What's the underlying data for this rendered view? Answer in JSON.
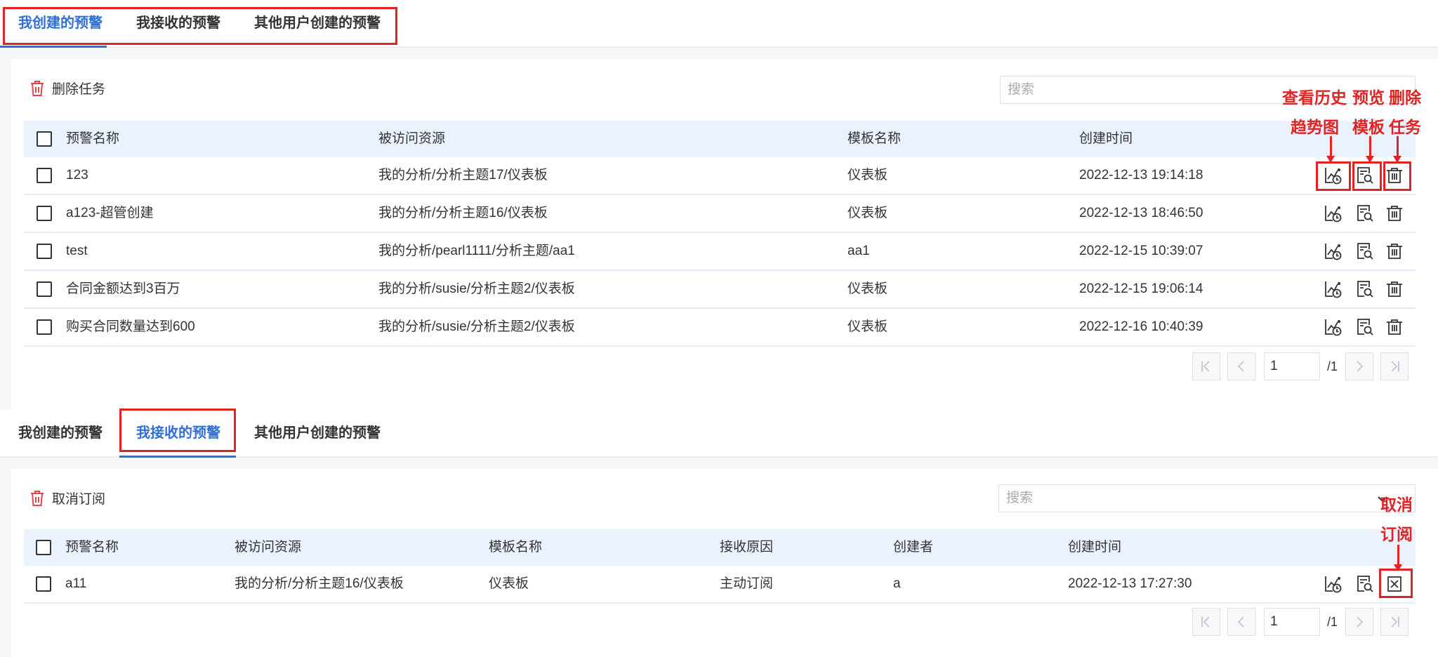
{
  "section1": {
    "tabs": [
      "我创建的预警",
      "我接收的预警",
      "其他用户创建的预警"
    ],
    "active_tab": 0,
    "toolbar": {
      "delete_label": "删除任务"
    },
    "search": {
      "placeholder": "搜索"
    },
    "columns": [
      "预警名称",
      "被访问资源",
      "模板名称",
      "创建时间"
    ],
    "rows": [
      {
        "name": "123",
        "resource": "我的分析/分析主题17/仪表板",
        "template": "仪表板",
        "created": "2022-12-13 19:14:18"
      },
      {
        "name": "a123-超管创建",
        "resource": "我的分析/分析主题16/仪表板",
        "template": "仪表板",
        "created": "2022-12-13 18:46:50"
      },
      {
        "name": "test",
        "resource": "我的分析/pearl1111/分析主题/aa1",
        "template": "aa1",
        "created": "2022-12-15 10:39:07"
      },
      {
        "name": "合同金额达到3百万",
        "resource": "我的分析/susie/分析主题2/仪表板",
        "template": "仪表板",
        "created": "2022-12-15 19:06:14"
      },
      {
        "name": "购买合同数量达到600",
        "resource": "我的分析/susie/分析主题2/仪表板",
        "template": "仪表板",
        "created": "2022-12-16 10:40:39"
      }
    ],
    "pagination": {
      "current": "1",
      "total": "/1"
    },
    "annotations": {
      "history_l1": "查看历史",
      "history_l2": "趋势图",
      "preview_l1": "预览",
      "preview_l2": "模板",
      "delete_l1": "删除",
      "delete_l2": "任务"
    }
  },
  "section2": {
    "tabs": [
      "我创建的预警",
      "我接收的预警",
      "其他用户创建的预警"
    ],
    "active_tab": 1,
    "toolbar": {
      "cancel_label": "取消订阅"
    },
    "search": {
      "placeholder": "搜索"
    },
    "columns": [
      "预警名称",
      "被访问资源",
      "模板名称",
      "接收原因",
      "创建者",
      "创建时间"
    ],
    "rows": [
      {
        "name": "a11",
        "resource": "我的分析/分析主题16/仪表板",
        "template": "仪表板",
        "reason": "主动订阅",
        "creator": "a",
        "created": "2022-12-13 17:27:30"
      }
    ],
    "pagination": {
      "current": "1",
      "total": "/1"
    },
    "annotations": {
      "cancel_l1": "取消",
      "cancel_l2": "订阅"
    }
  },
  "colors": {
    "accent": "#2f6fd8",
    "annotation_red": "#e02424",
    "header_bg": "#eaf2fd",
    "delete_icon": "#e04848"
  },
  "icons": [
    "trash-icon",
    "history-trend-icon",
    "preview-template-icon",
    "delete-icon",
    "cancel-subscribe-icon",
    "first-page-icon",
    "prev-page-icon",
    "next-page-icon",
    "last-page-icon",
    "chevron-down-icon"
  ]
}
